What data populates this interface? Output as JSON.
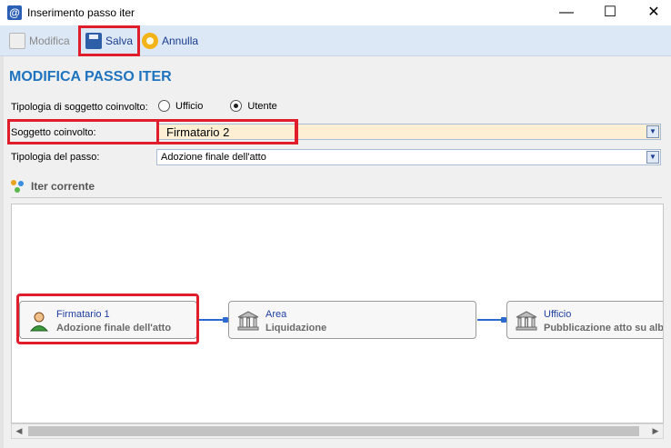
{
  "window": {
    "title": "Inserimento passo iter",
    "minimize_glyph": "—",
    "maximize_glyph": "☐",
    "close_glyph": "✕"
  },
  "toolbar": {
    "modifica_label": "Modifica",
    "salva_label": "Salva",
    "annulla_label": "Annulla"
  },
  "page": {
    "title": "MODIFICA PASSO ITER"
  },
  "form": {
    "tipologia_soggetto_label": "Tipologia di soggetto coinvolto:",
    "radio_ufficio": "Ufficio",
    "radio_utente": "Utente",
    "selected_radio": "Utente",
    "soggetto_label": "Soggetto coinvolto:",
    "soggetto_value": "Firmatario 2",
    "tipologia_passo_label": "Tipologia del passo:",
    "tipologia_passo_value": "Adozione finale dell'atto"
  },
  "iter": {
    "section_title": "Iter corrente",
    "nodes": [
      {
        "title": "Firmatario 1",
        "subtitle": "Adozione  finale  dell'atto",
        "icon": "user-icon",
        "highlighted": true
      },
      {
        "title": "Area",
        "subtitle": "Liquidazione",
        "icon": "building-icon",
        "highlighted": false
      },
      {
        "title": "Ufficio",
        "subtitle": "Pubblicazione  atto su  albo",
        "icon": "building-icon",
        "highlighted": false
      }
    ]
  },
  "colors": {
    "accent_title": "#1e73be",
    "highlight_red": "#e01d2a",
    "connector_blue": "#2b6ad1",
    "combo_highlight": "#fcefd4"
  }
}
